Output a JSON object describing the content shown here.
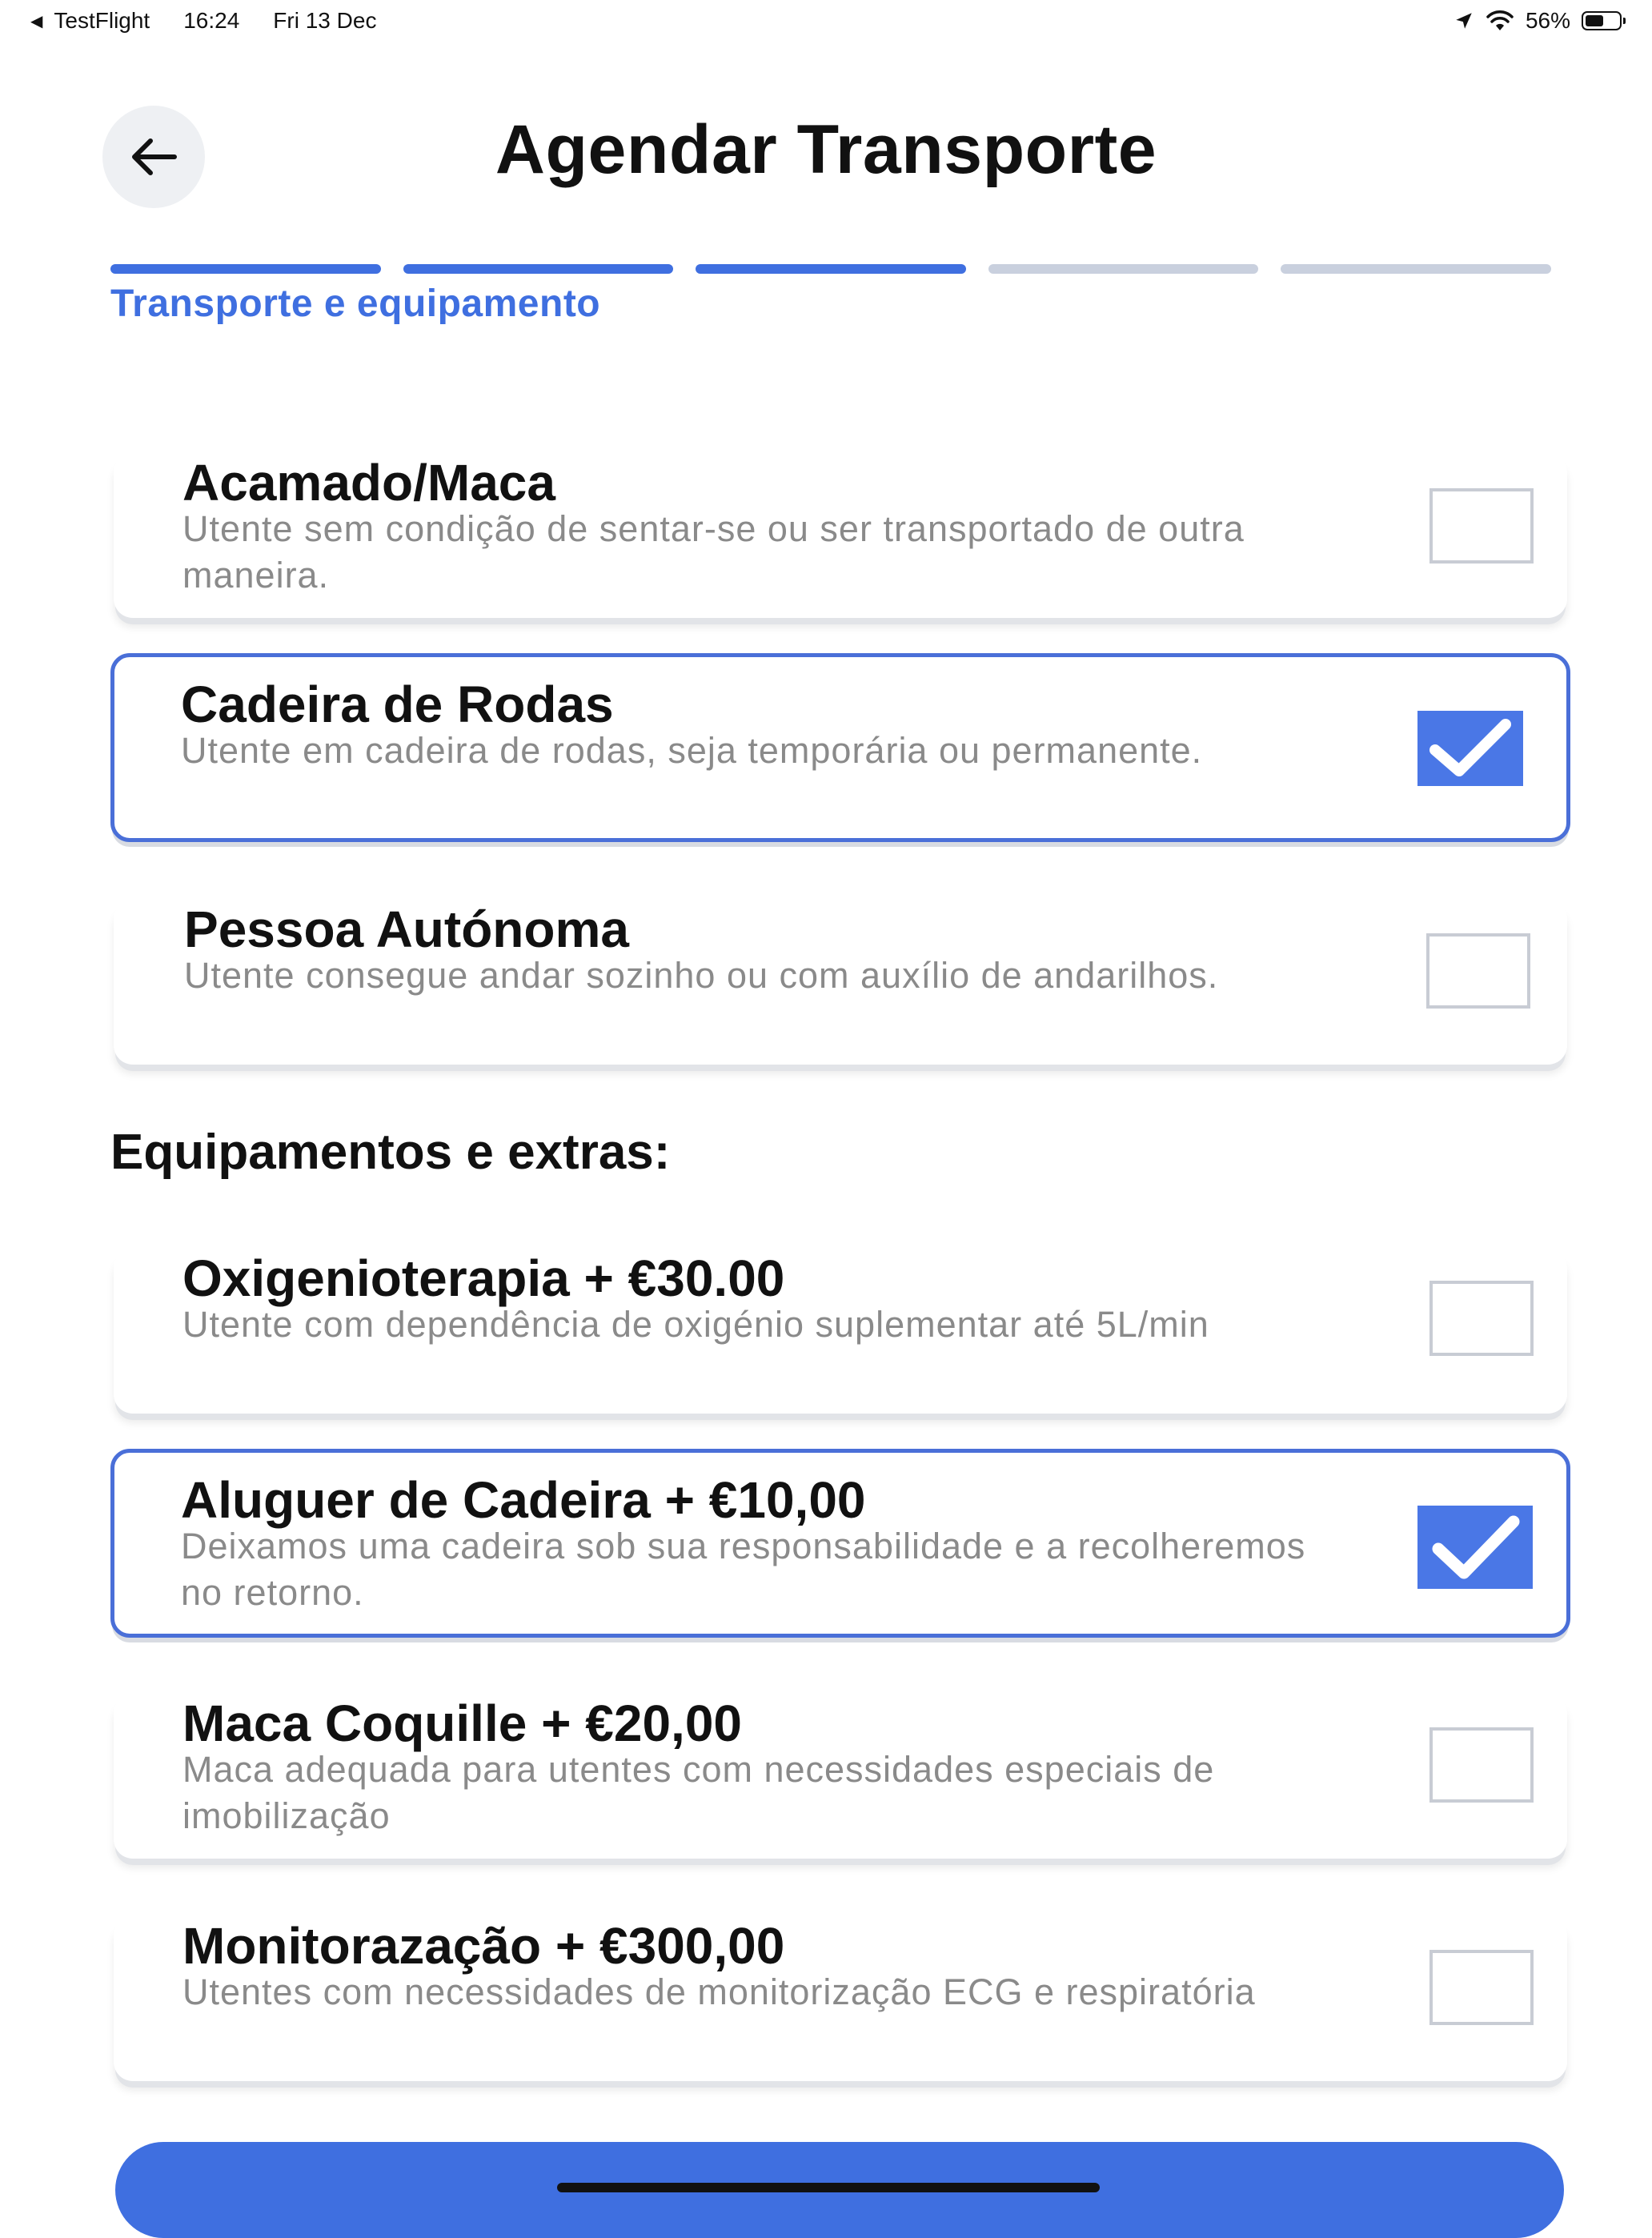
{
  "status_bar": {
    "app": "TestFlight",
    "time": "16:24",
    "date": "Fri 13 Dec",
    "battery": "56%",
    "battery_level": 0.56
  },
  "header": {
    "title": "Agendar Transporte"
  },
  "progress": {
    "total_steps": 5,
    "completed_steps": 3,
    "step_label": "Transporte e equipamento"
  },
  "transport_options": [
    {
      "title": "Acamado/Maca",
      "description": "Utente sem condição de sentar-se ou ser transportado de outra maneira.",
      "checked": false
    },
    {
      "title": "Cadeira de Rodas",
      "description": "Utente em cadeira de rodas, seja temporária ou permanente.",
      "checked": true
    },
    {
      "title": "Pessoa Autónoma",
      "description": "Utente consegue andar sozinho ou com auxílio de andarilhos.",
      "checked": false
    }
  ],
  "extras_section": {
    "title": "Equipamentos e extras:"
  },
  "extras": [
    {
      "title": "Oxigenioterapia + €30.00",
      "description": "Utente com dependência de oxigénio suplementar até 5L/min",
      "checked": false
    },
    {
      "title": "Aluguer de Cadeira + €10,00",
      "description": "Deixamos uma cadeira sob sua responsabilidade e a recolheremos no retorno.",
      "checked": true
    },
    {
      "title": "Maca Coquille + €20,00",
      "description": "Maca adequada para utentes com necessidades especiais de imobilização",
      "checked": false
    },
    {
      "title": "Monitorazação + €300,00",
      "description": "Utentes com necessidades de monitorização ECG e respiratória",
      "checked": false
    }
  ],
  "colors": {
    "accent": "#3f6fe0",
    "checkbox_checked": "#4a77e6",
    "progress_inactive": "#c9d0de",
    "description_text": "#8a8a8a"
  }
}
